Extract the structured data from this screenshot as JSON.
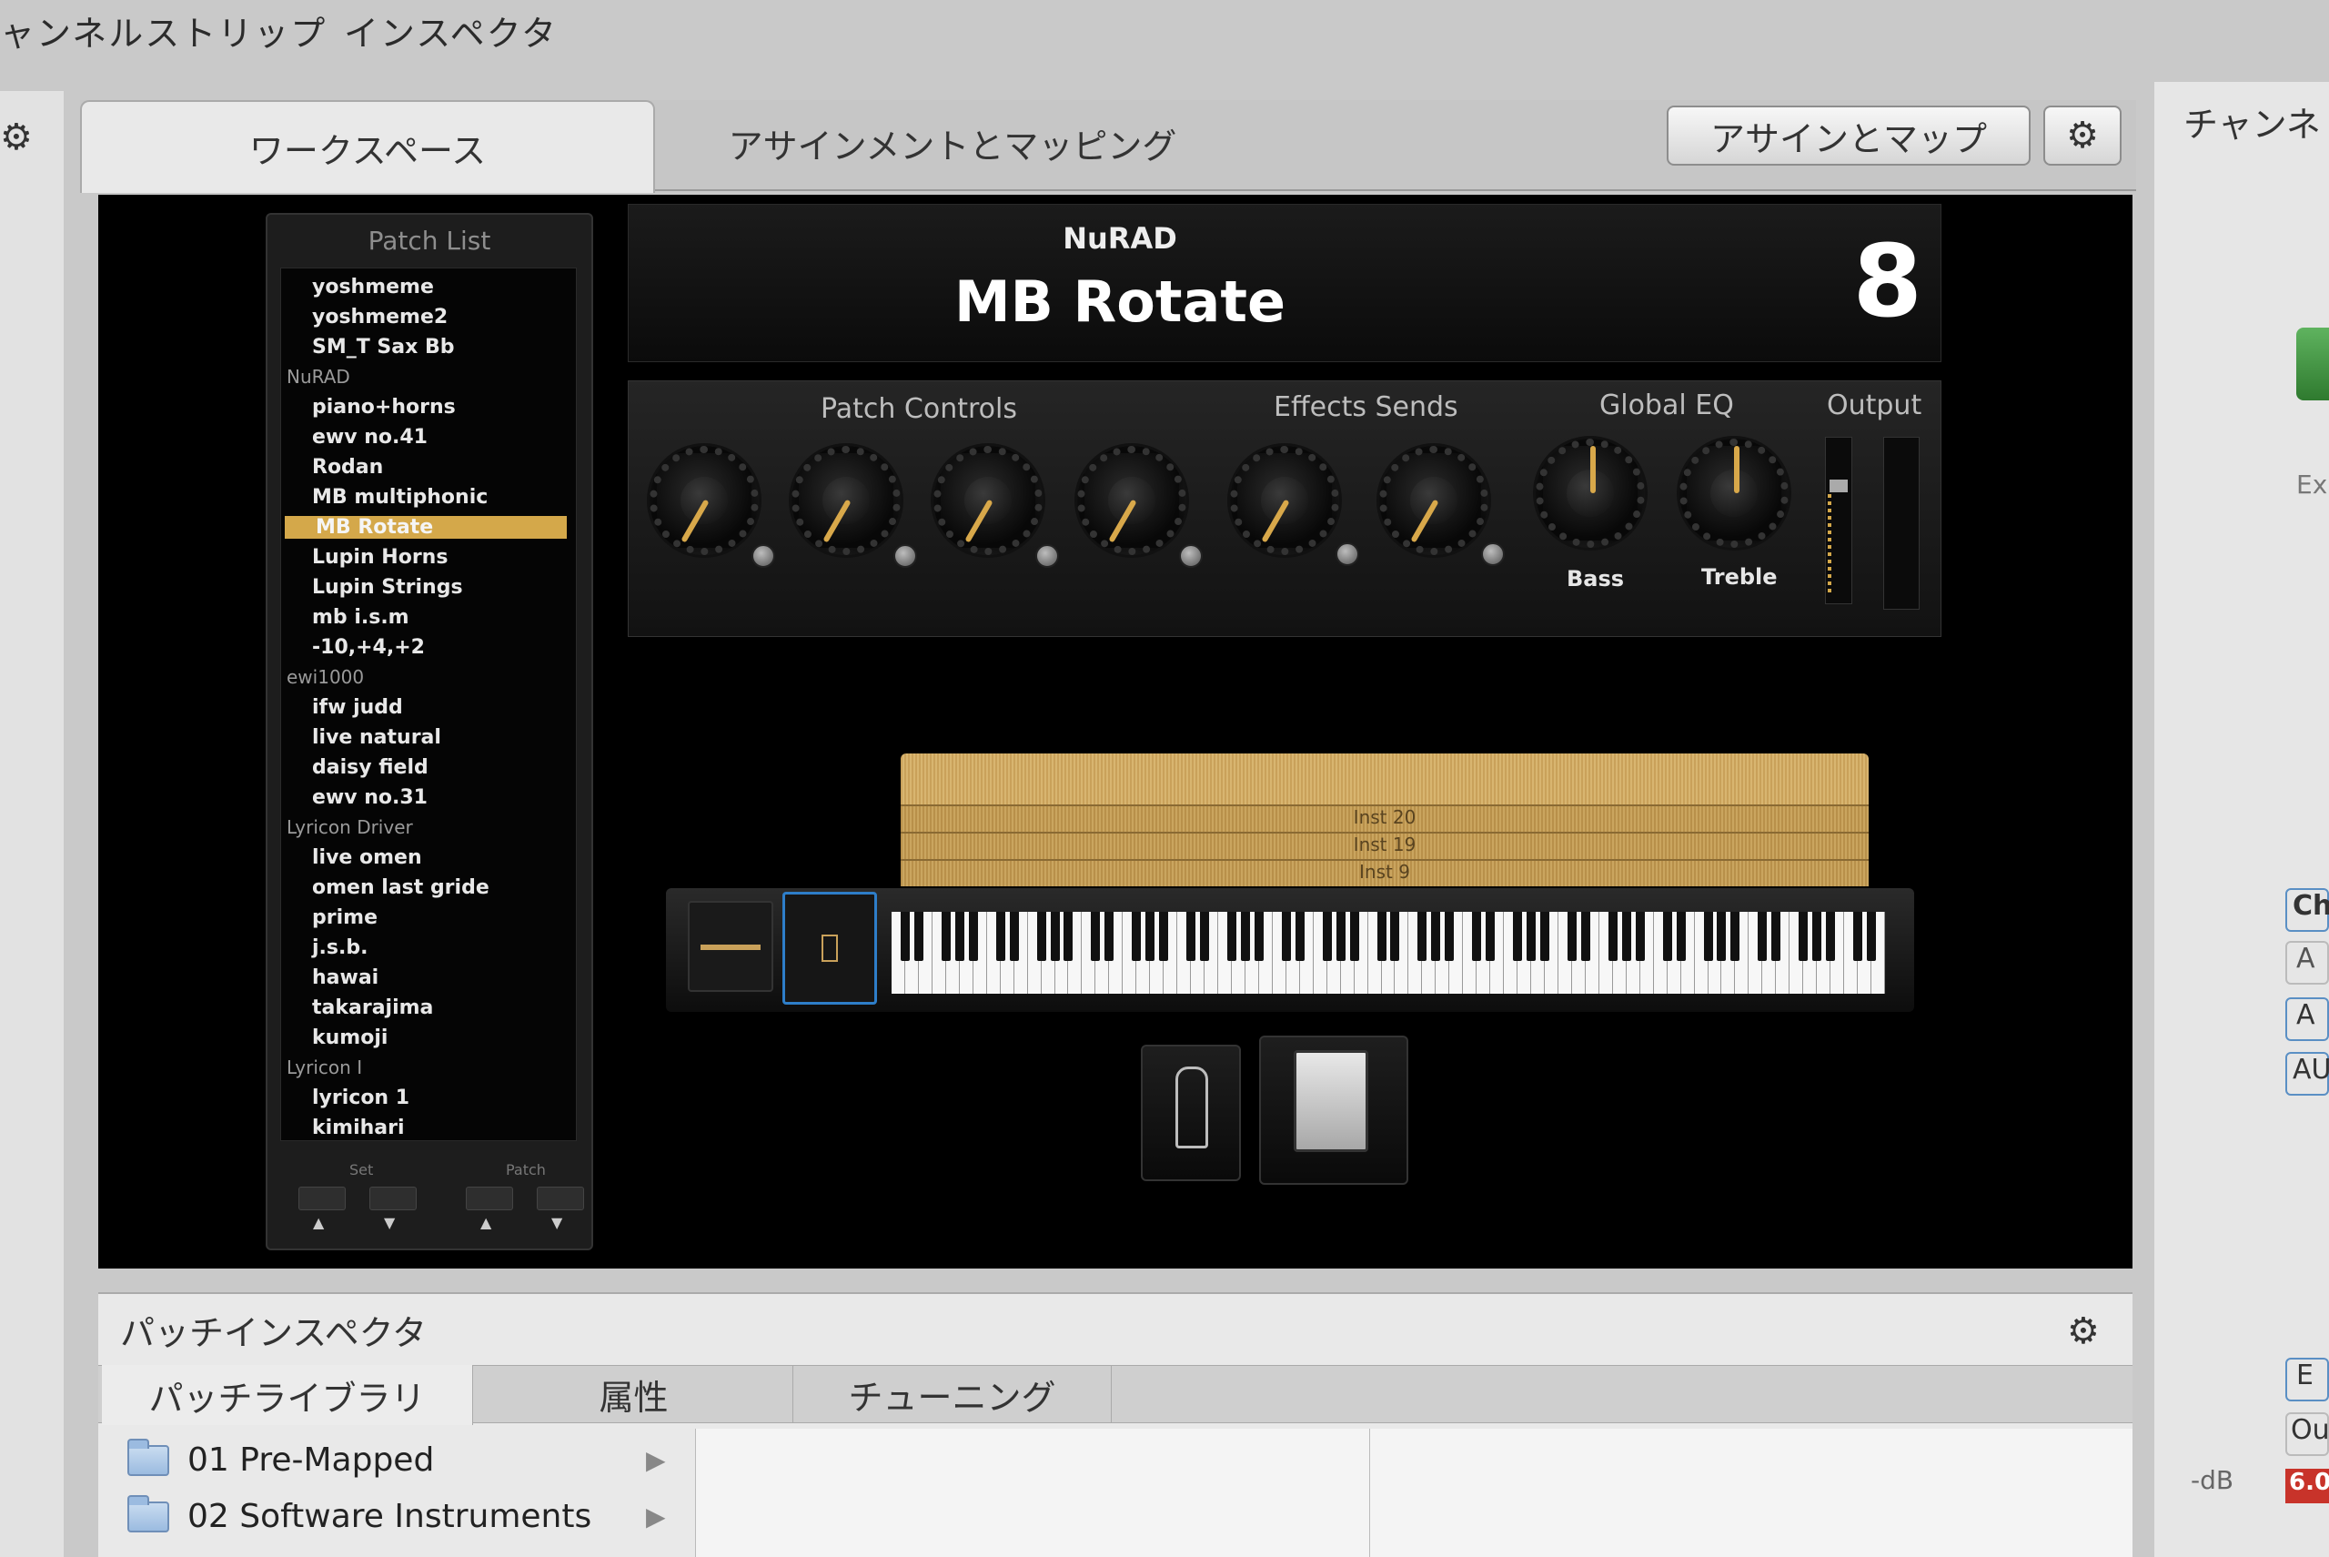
{
  "window": {
    "title_channel_strip": "ャンネルストリップ",
    "title_inspector": "インスペクタ"
  },
  "tabs": {
    "workspace": "ワークスペース",
    "assign_mapping": "アサインメントとマッピング",
    "assign_button": "アサインとマップ",
    "right_panel_title": "チャンネ"
  },
  "patch_list": {
    "title": "Patch List",
    "entries": [
      {
        "type": "item",
        "label": "yoshmeme"
      },
      {
        "type": "item",
        "label": "yoshmeme2"
      },
      {
        "type": "item",
        "label": "SM_T Sax Bb"
      },
      {
        "type": "group",
        "label": "NuRAD"
      },
      {
        "type": "item",
        "label": "piano+horns"
      },
      {
        "type": "item",
        "label": "ewv no.41"
      },
      {
        "type": "item",
        "label": "Rodan"
      },
      {
        "type": "item",
        "label": "MB multiphonic"
      },
      {
        "type": "item",
        "label": "MB Rotate",
        "selected": true
      },
      {
        "type": "item",
        "label": "Lupin Horns"
      },
      {
        "type": "item",
        "label": "Lupin Strings"
      },
      {
        "type": "item",
        "label": "mb i.s.m"
      },
      {
        "type": "item",
        "label": "-10,+4,+2"
      },
      {
        "type": "group",
        "label": "ewi1000"
      },
      {
        "type": "item",
        "label": "ifw judd"
      },
      {
        "type": "item",
        "label": "live natural"
      },
      {
        "type": "item",
        "label": "daisy field"
      },
      {
        "type": "item",
        "label": "ewv no.31"
      },
      {
        "type": "group",
        "label": "Lyricon Driver"
      },
      {
        "type": "item",
        "label": "live omen"
      },
      {
        "type": "item",
        "label": "omen last gride"
      },
      {
        "type": "item",
        "label": "prime"
      },
      {
        "type": "item",
        "label": "j.s.b."
      },
      {
        "type": "item",
        "label": "hawai"
      },
      {
        "type": "item",
        "label": "takarajima"
      },
      {
        "type": "item",
        "label": "kumoji"
      },
      {
        "type": "group",
        "label": "Lyricon I"
      },
      {
        "type": "item",
        "label": "lyricon 1"
      },
      {
        "type": "item",
        "label": "kimihari"
      }
    ],
    "set_label": "Set",
    "patch_label": "Patch"
  },
  "display": {
    "set_name": "NuRAD",
    "patch_name": "MB Rotate",
    "patch_number": "8"
  },
  "controls": {
    "patch_controls": "Patch Controls",
    "effects_sends": "Effects Sends",
    "global_eq": "Global EQ",
    "output": "Output",
    "bass": "Bass",
    "treble": "Treble"
  },
  "layers": [
    "Inst 20",
    "Inst 19",
    "Inst 9"
  ],
  "inspector": {
    "title": "パッチインスペクタ",
    "tabs": [
      "パッチライブラリ",
      "属性",
      "チューニング"
    ],
    "library": [
      "01 Pre-Mapped",
      "02 Software Instruments"
    ]
  },
  "right_fragments": {
    "ex": "Ex",
    "ch": "Ch",
    "a1": "A",
    "a2": "A",
    "au": "AU",
    "e": "E",
    "ou": "Ou",
    "db": "-dB",
    "level": "6.0"
  },
  "colors": {
    "accent": "#d4a84a",
    "bg_dark": "#000000"
  }
}
